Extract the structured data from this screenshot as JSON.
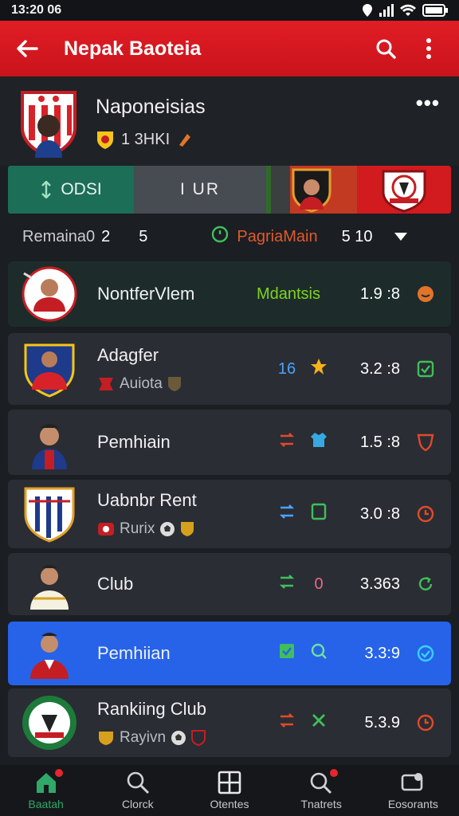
{
  "status_bar": {
    "time": "13:20 06"
  },
  "app_bar": {
    "title": "Nepak Baoteia"
  },
  "team": {
    "name": "Naponeisias",
    "sub": "1 3HKI"
  },
  "banner": {
    "left": "ODSI",
    "mid": "I  UR"
  },
  "filter": {
    "label": "Remaina0",
    "num": "2",
    "num2": "5",
    "league": "PagriaMain",
    "range": "5  10"
  },
  "rows": [
    {
      "name": "NontferVlem",
      "tag": "Mdantsis",
      "tag_color": "#7ed321",
      "score": "1.9 :8",
      "end_color": "#e2742a"
    },
    {
      "name": "Adagfer",
      "sub": "Auiota",
      "m1": "16",
      "m1_color": "#4aa3ff",
      "score": "3.2 :8",
      "end_color": "#3fbf5a"
    },
    {
      "name": "Pemhiain",
      "score": "1.5 :8",
      "end_color": "#e2492a"
    },
    {
      "name": "Uabnbr Rent",
      "sub": "Rurix",
      "score": "3.0 :8",
      "end_color": "#e2492a"
    },
    {
      "name": "Club",
      "m2": "0",
      "m2_color": "#e66a8a",
      "score": "3.363",
      "end_color": "#3fbf5a"
    },
    {
      "name": "Pemhiian",
      "score": "3.3:9",
      "end_color": "#38d0ff"
    },
    {
      "name": "Rankiing Club",
      "sub": "Rayivn",
      "score": "5.3.9",
      "end_color": "#e2492a"
    }
  ],
  "nav": [
    {
      "label": "Baatah"
    },
    {
      "label": "Clorck"
    },
    {
      "label": "Otentes"
    },
    {
      "label": "Tnatrets"
    },
    {
      "label": "Eosorants"
    }
  ]
}
